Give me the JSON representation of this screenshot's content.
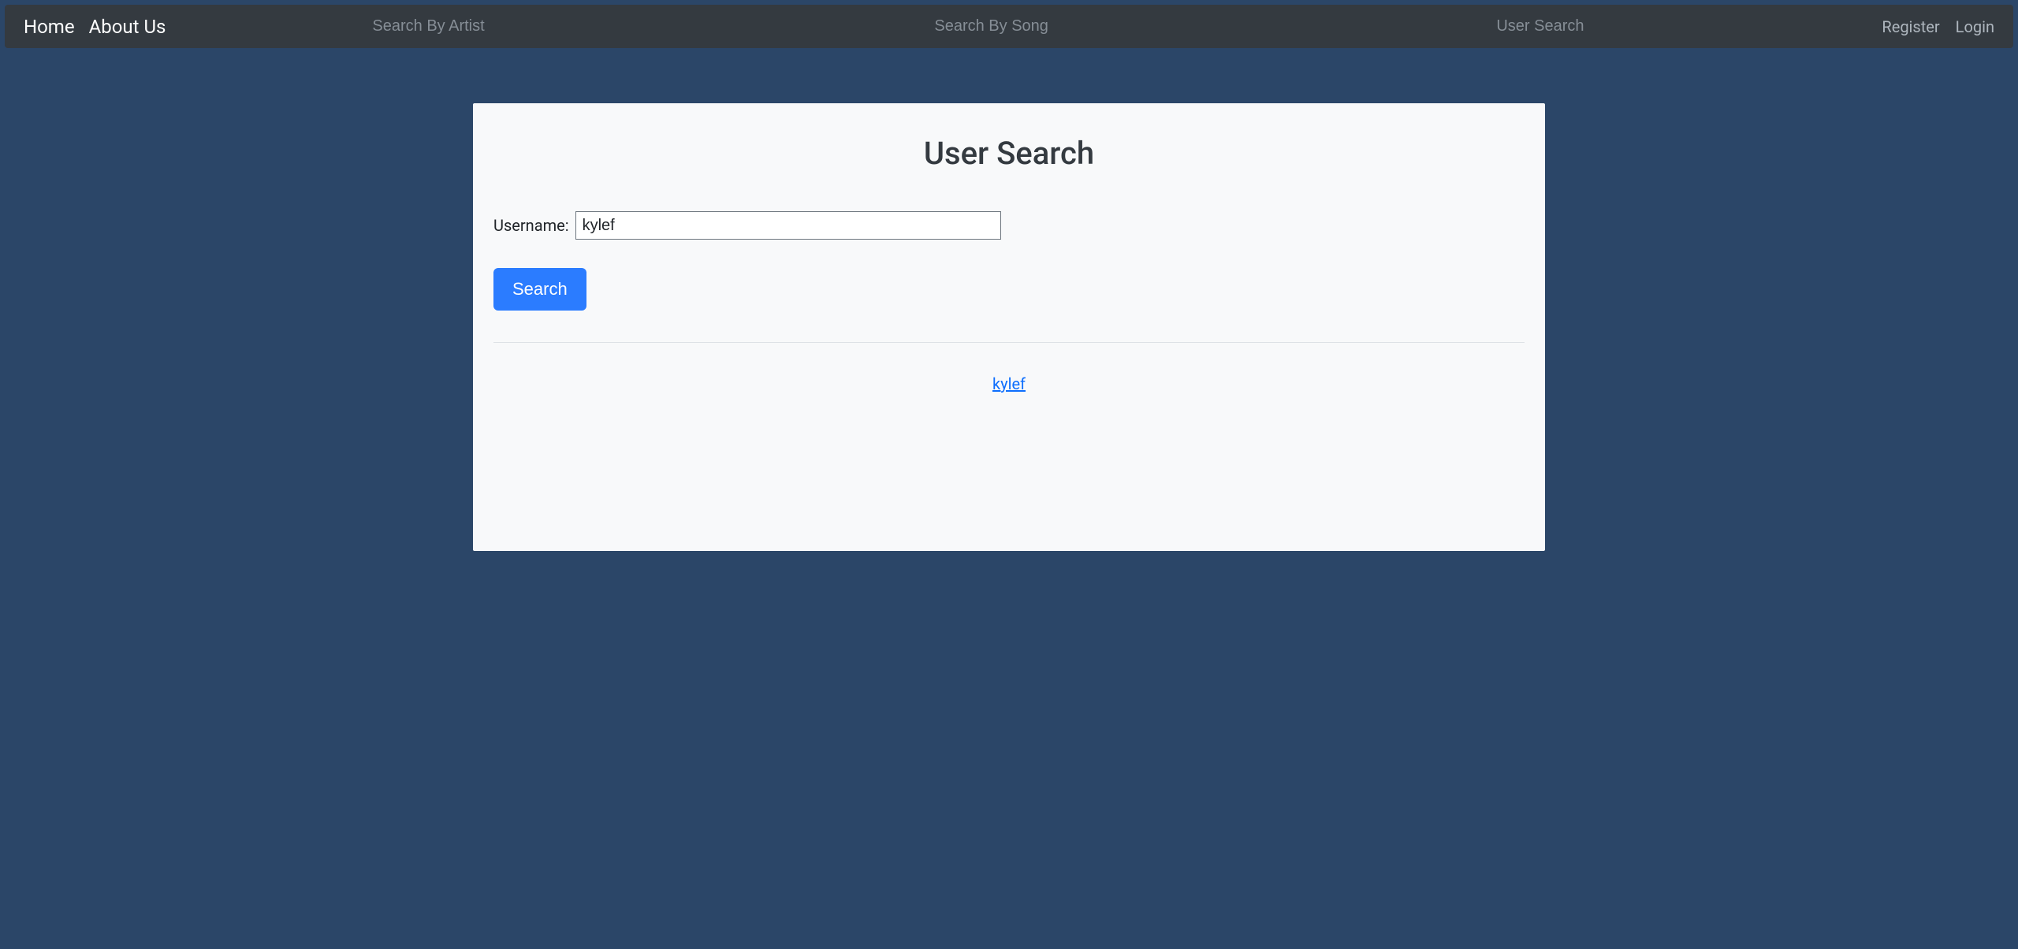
{
  "navbar": {
    "home_label": "Home",
    "about_label": "About Us",
    "artist_placeholder": "Search By Artist",
    "song_placeholder": "Search By Song",
    "user_placeholder": "User Search",
    "register_label": "Register",
    "login_label": "Login"
  },
  "main": {
    "title": "User Search",
    "username_label": "Username:",
    "username_value": "kylef",
    "search_button_label": "Search"
  },
  "results": {
    "items": [
      "kylef"
    ]
  }
}
